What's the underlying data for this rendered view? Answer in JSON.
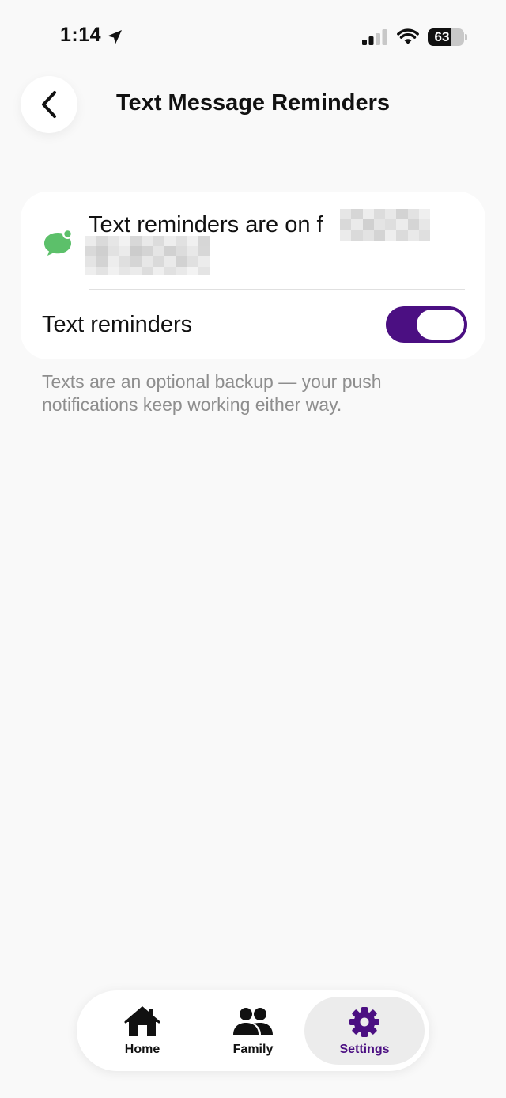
{
  "status_bar": {
    "time": "1:14",
    "battery_level": "63",
    "battery_fraction": 0.63
  },
  "header": {
    "back_icon": "chevron-left-icon",
    "title": "Text Message Reminders"
  },
  "card": {
    "icon": "chat-bubble-icon",
    "status_text": "Text reminders are on f",
    "toggle_label": "Text reminders",
    "toggle_on": true
  },
  "footnote": "Texts are an optional backup — your push notifications keep working either way.",
  "tab_bar": {
    "tabs": [
      {
        "label": "Home",
        "icon": "home-icon"
      },
      {
        "label": "Family",
        "icon": "family-icon"
      },
      {
        "label": "Settings",
        "icon": "gear-icon",
        "selected": true
      }
    ]
  },
  "colors": {
    "accent": "#4b0f82",
    "sms_green": "#5cc06a",
    "background": "#f9f9f9",
    "muted_text": "#8e8e8e"
  }
}
